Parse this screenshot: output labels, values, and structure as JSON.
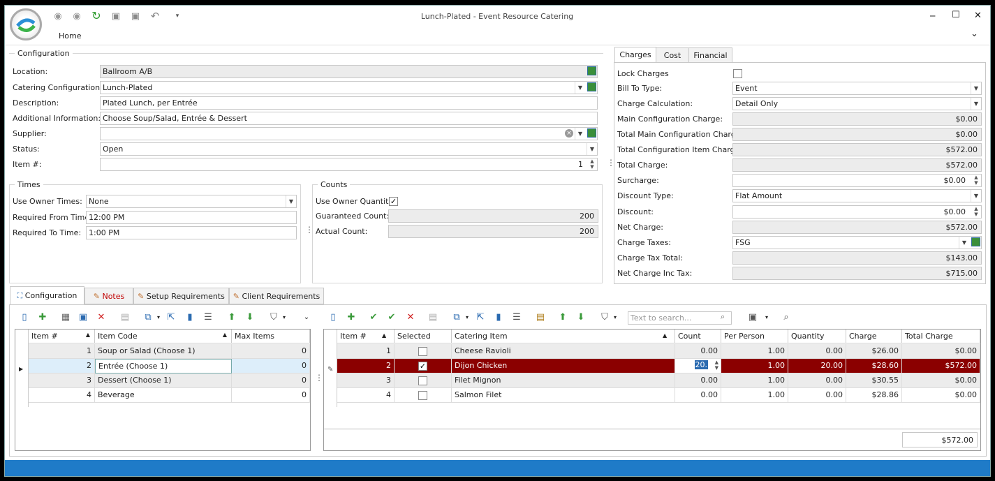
{
  "window": {
    "title": "Lunch-Plated - Event Resource Catering",
    "ribbon_tab": "Home",
    "min": "─",
    "max": "☐",
    "close": "✕",
    "expand": "⌄"
  },
  "config": {
    "group_title": "Configuration",
    "location_label": "Location:",
    "location": "Ballroom A/B",
    "catconf_label": "Catering Configuration:*",
    "catconf": "Lunch-Plated",
    "desc_label": "Description:",
    "desc": "Plated Lunch, per Entrée",
    "addinfo_label": "Additional Information:",
    "addinfo": "Choose Soup/Salad, Entrée & Dessert",
    "supplier_label": "Supplier:",
    "supplier": "",
    "status_label": "Status:",
    "status": "Open",
    "itemno_label": "Item #:",
    "itemno": "1"
  },
  "times": {
    "group_title": "Times",
    "owner_label": "Use Owner Times:",
    "owner": "None",
    "from_label": "Required From Time:",
    "from": "12:00 PM",
    "to_label": "Required To Time:",
    "to": "1:00 PM"
  },
  "counts": {
    "group_title": "Counts",
    "owner_qty_label": "Use Owner Quantity",
    "owner_qty_checked": "✓",
    "guaranteed_label": "Guaranteed Count:",
    "guaranteed": "200",
    "actual_label": "Actual Count:",
    "actual": "200"
  },
  "charges": {
    "tabs": [
      "Charges",
      "Cost",
      "Financial"
    ],
    "lock_label": "Lock Charges",
    "billto_label": "Bill To Type:",
    "billto": "Event",
    "calc_label": "Charge Calculation:",
    "calc": "Detail Only",
    "main_label": "Main Configuration Charge:",
    "main": "$0.00",
    "totalmain_label": "Total Main Configuration Charge:",
    "totalmain": "$0.00",
    "totalitem_label": "Total Configuration Item Charge:",
    "totalitem": "$572.00",
    "total_label": "Total Charge:",
    "total": "$572.00",
    "surcharge_label": "Surcharge:",
    "surcharge": "$0.00",
    "disctype_label": "Discount Type:",
    "disctype": "Flat Amount",
    "discount_label": "Discount:",
    "discount": "$0.00",
    "net_label": "Net Charge:",
    "net": "$572.00",
    "taxes_label": "Charge Taxes:",
    "taxes": "FSG",
    "taxtotal_label": "Charge Tax Total:",
    "taxtotal": "$143.00",
    "netinc_label": "Net Charge Inc Tax:",
    "netinc": "$715.00"
  },
  "bottom_tabs": [
    "Configuration",
    "Notes",
    "Setup Requirements",
    "Client Requirements"
  ],
  "left_grid": {
    "headers": [
      "Item #",
      "Item Code",
      "Max Items"
    ],
    "rows": [
      [
        "1",
        "Soup or Salad (Choose 1)",
        "0"
      ],
      [
        "2",
        "Entrée (Choose 1)",
        "0"
      ],
      [
        "3",
        "Dessert (Choose 1)",
        "0"
      ],
      [
        "4",
        "Beverage",
        "0"
      ]
    ]
  },
  "search": {
    "placeholder": "Text to search..."
  },
  "right_grid": {
    "headers": [
      "Item #",
      "Selected",
      "Catering Item",
      "Count",
      "Per Person",
      "Quantity",
      "Charge",
      "Total Charge"
    ],
    "rows": [
      [
        "1",
        "",
        "Cheese Ravioli",
        "0.00",
        "1.00",
        "0.00",
        "$26.00",
        "$0.00"
      ],
      [
        "2",
        "✓",
        "Dijon Chicken",
        "20.",
        "1.00",
        "20.00",
        "$28.60",
        "$572.00"
      ],
      [
        "3",
        "",
        "Filet Mignon",
        "0.00",
        "1.00",
        "0.00",
        "$30.55",
        "$0.00"
      ],
      [
        "4",
        "",
        "Salmon Filet",
        "0.00",
        "1.00",
        "0.00",
        "$28.86",
        "$0.00"
      ]
    ],
    "footer_total": "$572.00"
  },
  "colors": {
    "selected_row": "#8b0000",
    "status_bar": "#1f7bc8",
    "accent": "#3a8f3a"
  }
}
